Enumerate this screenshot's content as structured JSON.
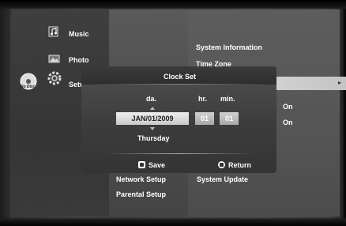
{
  "menu": {
    "categories": [
      {
        "label": "Music",
        "icon": "music-icon"
      },
      {
        "label": "Photo",
        "icon": "photo-icon"
      },
      {
        "label": "Setup",
        "icon": "gear-icon"
      }
    ],
    "disc_label": "No Disc"
  },
  "submenu": {
    "items": [
      "Network Setup",
      "Parental Setup"
    ]
  },
  "options": {
    "items": [
      "System Information",
      "Time Zone",
      "System Update"
    ],
    "values": [
      "On",
      "On"
    ]
  },
  "dialog": {
    "title": "Clock Set",
    "date_label": "da.",
    "hour_label": "hr.",
    "minute_label": "min.",
    "date_value": "JAN/01/2009",
    "hour_value": "01",
    "minute_value": "01",
    "weekday": "Thursday",
    "save_label": "Save",
    "return_label": "Return"
  },
  "colors": {
    "highlight": "#c8c8c8",
    "dialog_bg": "#444444",
    "text": "#ffffff"
  }
}
